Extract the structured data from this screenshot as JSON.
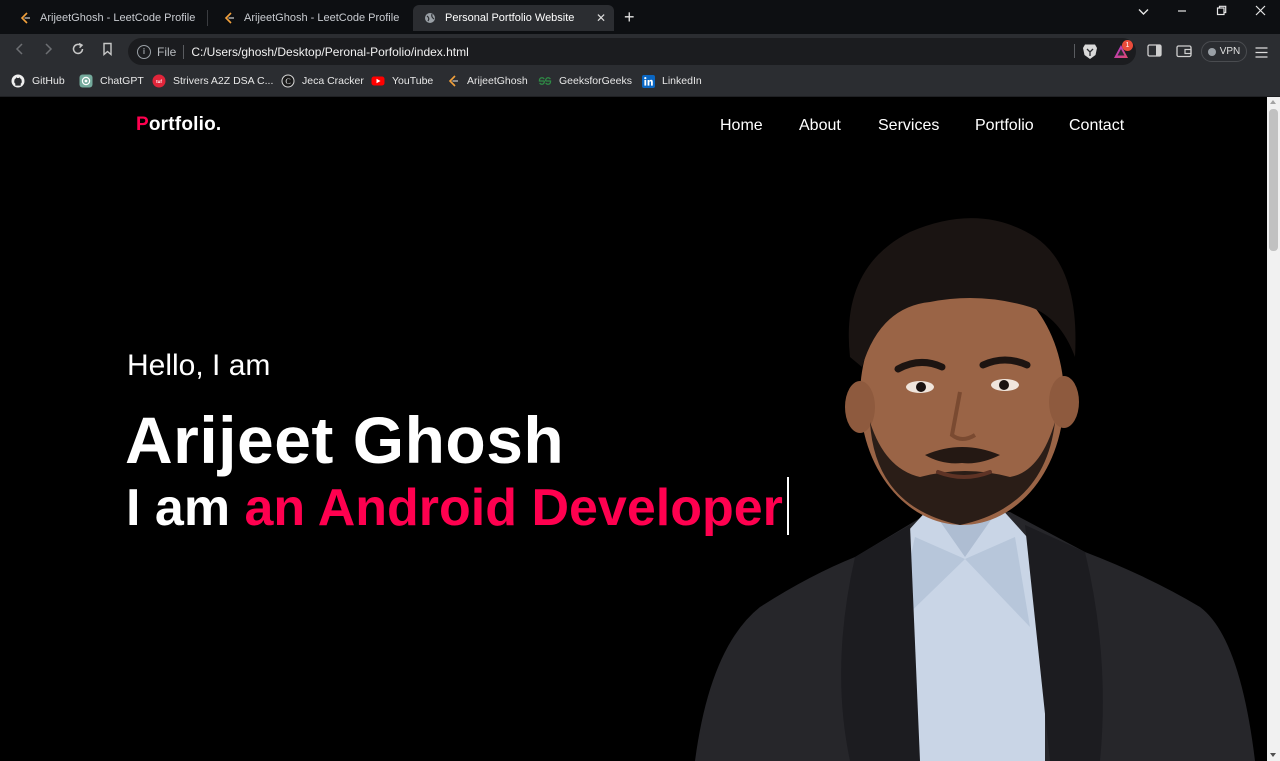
{
  "browser": {
    "tabs": [
      {
        "title": "ArijeetGhosh - LeetCode Profile",
        "icon": "leetcode-icon",
        "active": false
      },
      {
        "title": "ArijeetGhosh - LeetCode Profile",
        "icon": "leetcode-icon",
        "active": false
      },
      {
        "title": "Personal Portfolio Website",
        "icon": "globe-icon",
        "active": true
      }
    ],
    "address": {
      "scheme": "File",
      "url": "C:/Users/ghosh/Desktop/Peronal-Porfolio/index.html"
    },
    "rewards_badge": "1",
    "vpn_label": "VPN",
    "bookmarks": [
      {
        "label": "GitHub",
        "icon": "github-icon"
      },
      {
        "label": "ChatGPT",
        "icon": "chatgpt-icon"
      },
      {
        "label": "Strivers A2Z DSA C...",
        "icon": "takeuforward-icon"
      },
      {
        "label": "Jeca Cracker",
        "icon": "jeca-icon"
      },
      {
        "label": "YouTube",
        "icon": "youtube-icon"
      },
      {
        "label": "ArijeetGhosh",
        "icon": "leetcode-icon"
      },
      {
        "label": "GeeksforGeeks",
        "icon": "geeksforgeeks-icon"
      },
      {
        "label": "LinkedIn",
        "icon": "linkedin-icon"
      }
    ]
  },
  "page": {
    "logo": {
      "accent": "P",
      "rest": "ortfolio."
    },
    "nav": [
      "Home",
      "About",
      "Services",
      "Portfolio",
      "Contact"
    ],
    "hero": {
      "greeting": "Hello, I am",
      "name": "Arijeet Ghosh",
      "role_prefix": "I am ",
      "role_typed": "an Android Developer"
    }
  },
  "colors": {
    "accent": "#ff004f",
    "background": "#000000"
  }
}
